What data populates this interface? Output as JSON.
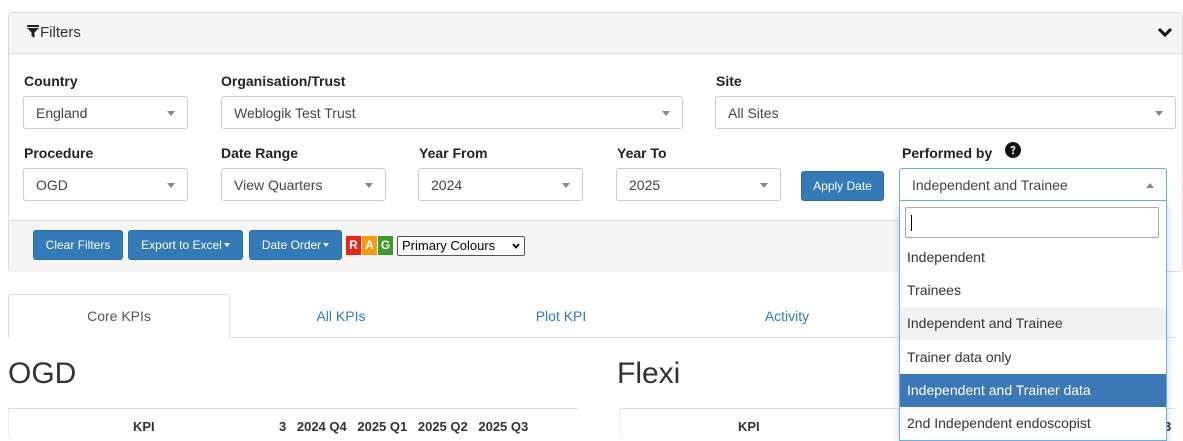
{
  "filters": {
    "title": "Filters",
    "country": {
      "label": "Country",
      "value": "England"
    },
    "organisation": {
      "label": "Organisation/Trust",
      "value": "Weblogik Test Trust"
    },
    "site": {
      "label": "Site",
      "value": "All Sites"
    },
    "procedure": {
      "label": "Procedure",
      "value": "OGD"
    },
    "date_range": {
      "label": "Date Range",
      "value": "View Quarters"
    },
    "year_from": {
      "label": "Year From",
      "value": "2024"
    },
    "year_to": {
      "label": "Year To",
      "value": "2025"
    },
    "apply_date": "Apply Date",
    "performed_by": {
      "label": "Performed by",
      "value": "Independent and Trainee",
      "search_value": "",
      "options": [
        "Independent",
        "Trainees",
        "Independent and Trainee",
        "Trainer data only",
        "Independent and Trainer data",
        "2nd Independent endoscopist"
      ],
      "selected_option": "Independent and Trainee",
      "highlighted_option": "Independent and Trainer data"
    }
  },
  "toolbar": {
    "clear_filters": "Clear Filters",
    "export_excel": "Export to Excel",
    "date_order": "Date Order",
    "rag": {
      "r": "R",
      "a": "A",
      "g": "G"
    },
    "colour_scheme": "Primary Colours"
  },
  "tabs": [
    "Core KPIs",
    "All KPIs",
    "Plot KPI",
    "Activity"
  ],
  "sections": {
    "left": {
      "title": "OGD",
      "kpi_header": "KPI",
      "quarters": [
        "3",
        "2024 Q4",
        "2025 Q1",
        "2025 Q2",
        "2025 Q3"
      ]
    },
    "right": {
      "title": "Flexi",
      "kpi_header": "KPI",
      "quarter_fragment": "3"
    }
  },
  "colors": {
    "primary": "#337ab7",
    "rag_red": "#e8261c",
    "rag_amber": "#f29a12",
    "rag_green": "#3f9a2f",
    "highlight": "#3b78b5"
  }
}
